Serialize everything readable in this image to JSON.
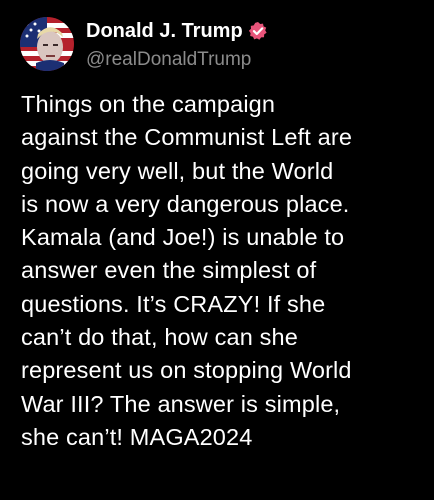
{
  "post": {
    "author": {
      "display_name": "Donald J. Trump",
      "handle": "@realDonaldTrump",
      "verified_icon": "verified-badge-icon",
      "avatar_icon": "avatar"
    },
    "text": "Things on the campaign\nagainst the Communist Left are\ngoing very well, but the World\nis now a very dangerous place.\nKamala (and Joe!) is unable to\nanswer even the simplest of\nquestions. It’s CRAZY! If she\ncan’t do that, how can she\nrepresent us on stopping World\nWar III? The answer is simple,\nshe can’t! MAGA2024"
  },
  "colors": {
    "background": "#000000",
    "text": "#ffffff",
    "handle": "#8b8b8b",
    "verified_badge": "#e8547a"
  }
}
